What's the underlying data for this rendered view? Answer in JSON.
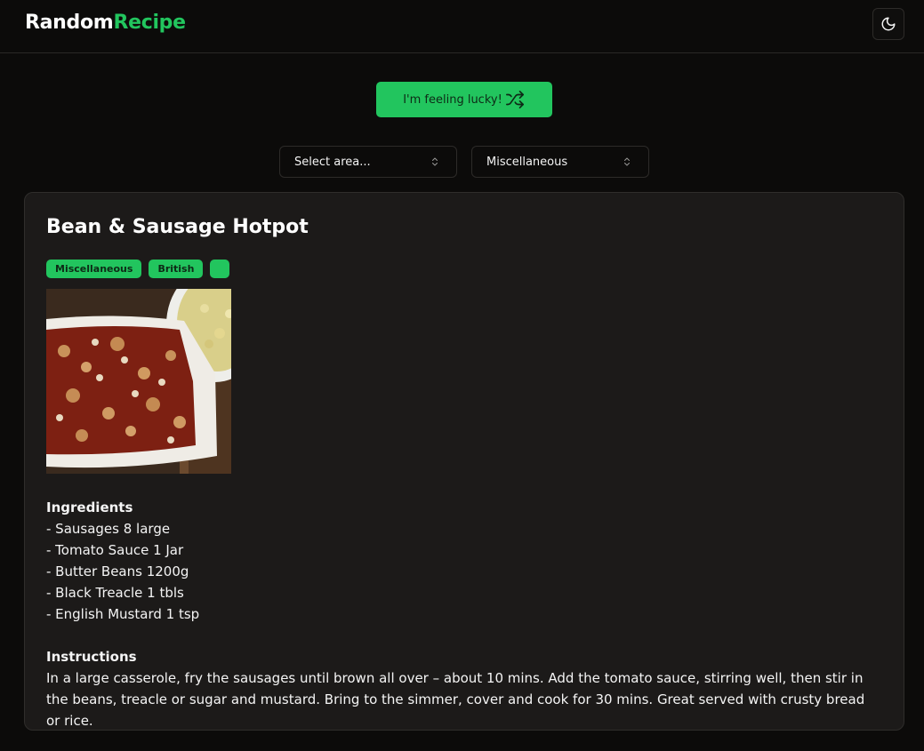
{
  "header": {
    "logo_part1": "Random",
    "logo_part2": "Recipe",
    "theme_toggle_icon": "moon-icon"
  },
  "actions": {
    "lucky_label": "I'm feeling lucky!",
    "lucky_icon": "shuffle-icon"
  },
  "filters": {
    "area_select": "Select area...",
    "category_select": "Miscellaneous"
  },
  "recipe": {
    "title": "Bean & Sausage Hotpot",
    "tags": [
      "Miscellaneous",
      "British",
      ""
    ],
    "ingredients_heading": "Ingredients",
    "ingredients": [
      "- Sausages 8 large",
      "- Tomato Sauce 1 Jar",
      "- Butter Beans 1200g",
      "- Black Treacle 1 tbls",
      "- English Mustard 1 tsp"
    ],
    "instructions_heading": "Instructions",
    "instructions": "In a large casserole, fry the sausages until brown all over – about 10 mins. Add the tomato sauce, stirring well, then stir in the beans, treacle or sugar and mustard. Bring to the simmer, cover and cook for 30 mins. Great served with crusty bread or rice."
  },
  "colors": {
    "accent": "#22c55e",
    "background": "#0c0b0a",
    "card": "#1c1a19"
  }
}
